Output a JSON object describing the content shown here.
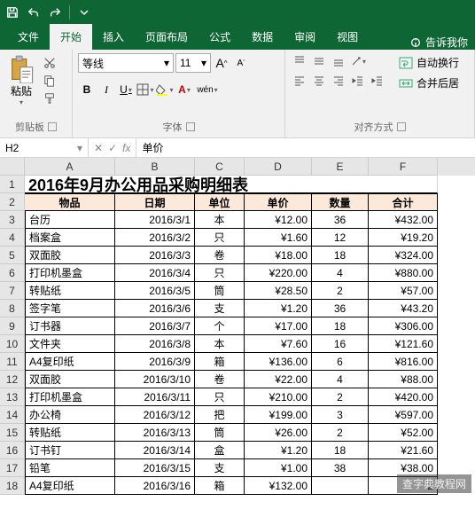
{
  "qat": {
    "save": "save",
    "undo": "undo",
    "redo": "redo"
  },
  "tabs": {
    "file": "文件",
    "home": "开始",
    "insert": "插入",
    "layout": "页面布局",
    "formulas": "公式",
    "data": "数据",
    "review": "审阅",
    "view": "视图",
    "tell_me": "告诉我你"
  },
  "ribbon": {
    "clipboard": {
      "paste": "粘贴",
      "label": "剪贴板"
    },
    "font": {
      "name": "等线",
      "size": "11",
      "bold": "B",
      "italic": "I",
      "underline": "U",
      "wen_char": "wén",
      "label": "字体",
      "grow": "A",
      "shrink": "A"
    },
    "align": {
      "wrap": "自动换行",
      "merge": "合并后居",
      "label": "对齐方式"
    }
  },
  "namebox": "H2",
  "formula_value": "单价",
  "columns": [
    "A",
    "B",
    "C",
    "D",
    "E",
    "F"
  ],
  "title_cell": "2016年9月办公用品采购明细表",
  "headers": [
    "物品",
    "日期",
    "单位",
    "单价",
    "数量",
    "合计"
  ],
  "rows": [
    [
      "台历",
      "2016/3/1",
      "本",
      "¥12.00",
      "36",
      "¥432.00"
    ],
    [
      "档案盒",
      "2016/3/2",
      "只",
      "¥1.60",
      "12",
      "¥19.20"
    ],
    [
      "双面胶",
      "2016/3/3",
      "卷",
      "¥18.00",
      "18",
      "¥324.00"
    ],
    [
      "打印机墨盒",
      "2016/3/4",
      "只",
      "¥220.00",
      "4",
      "¥880.00"
    ],
    [
      "转贴纸",
      "2016/3/5",
      "筒",
      "¥28.50",
      "2",
      "¥57.00"
    ],
    [
      "签字笔",
      "2016/3/6",
      "支",
      "¥1.20",
      "36",
      "¥43.20"
    ],
    [
      "订书器",
      "2016/3/7",
      "个",
      "¥17.00",
      "18",
      "¥306.00"
    ],
    [
      "文件夹",
      "2016/3/8",
      "本",
      "¥7.60",
      "16",
      "¥121.60"
    ],
    [
      "A4复印纸",
      "2016/3/9",
      "箱",
      "¥136.00",
      "6",
      "¥816.00"
    ],
    [
      "双面胶",
      "2016/3/10",
      "卷",
      "¥22.00",
      "4",
      "¥88.00"
    ],
    [
      "打印机墨盒",
      "2016/3/11",
      "只",
      "¥210.00",
      "2",
      "¥420.00"
    ],
    [
      "办公椅",
      "2016/3/12",
      "把",
      "¥199.00",
      "3",
      "¥597.00"
    ],
    [
      "转贴纸",
      "2016/3/13",
      "筒",
      "¥26.00",
      "2",
      "¥52.00"
    ],
    [
      "订书钉",
      "2016/3/14",
      "盒",
      "¥1.20",
      "18",
      "¥21.60"
    ],
    [
      "铅笔",
      "2016/3/15",
      "支",
      "¥1.00",
      "38",
      "¥38.00"
    ],
    [
      "A4复印纸",
      "2016/3/16",
      "箱",
      "¥132.00",
      "",
      "2"
    ]
  ],
  "watermark": "查字典教程网"
}
